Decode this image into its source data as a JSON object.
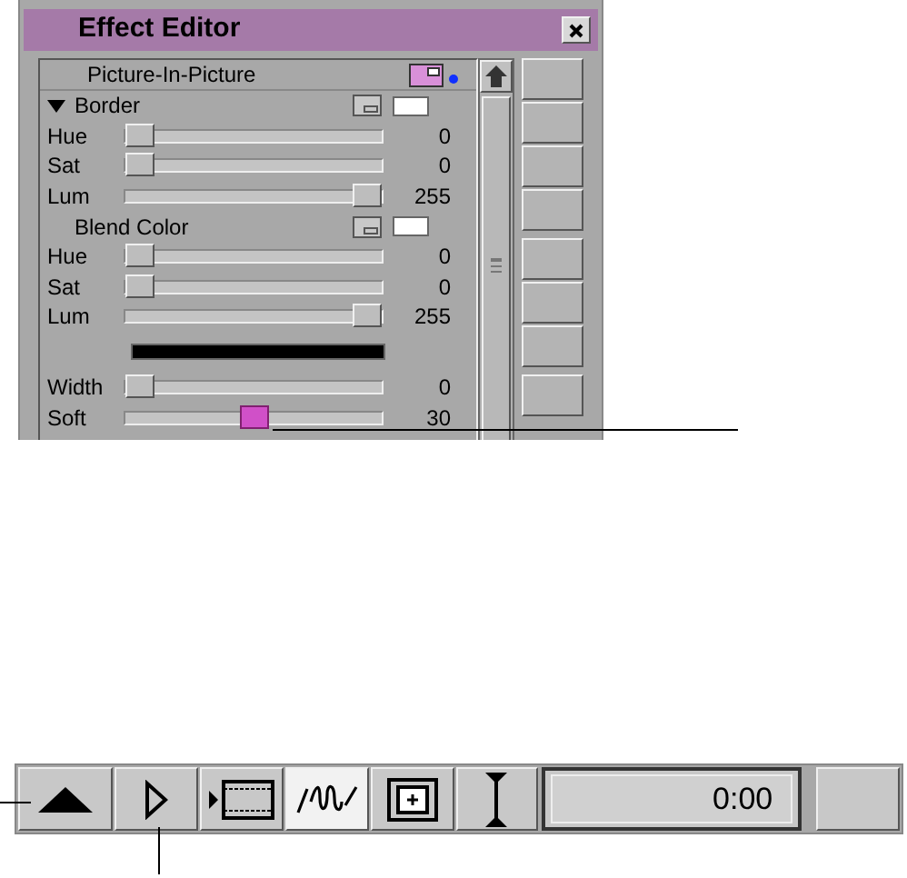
{
  "window": {
    "title": "Effect Editor"
  },
  "effect": {
    "name": "Picture-In-Picture"
  },
  "rows": [
    {
      "kind": "section",
      "label": "Border",
      "expanded": true
    },
    {
      "kind": "slider",
      "label": "Hue",
      "level": 0,
      "reading": "0",
      "selected": false
    },
    {
      "kind": "slider",
      "label": "Sat",
      "level": 0,
      "reading": "0",
      "selected": false
    },
    {
      "kind": "slider",
      "label": "Lum",
      "level": 1,
      "reading": "255",
      "selected": false
    },
    {
      "kind": "section",
      "label": "Blend Color"
    },
    {
      "kind": "slider",
      "label": "Hue",
      "level": 0,
      "reading": "0",
      "selected": false
    },
    {
      "kind": "slider",
      "label": "Sat",
      "level": 0,
      "reading": "0",
      "selected": false
    },
    {
      "kind": "slider",
      "label": "Lum",
      "level": 1,
      "reading": "255",
      "selected": false
    },
    {
      "kind": "color_bar"
    },
    {
      "kind": "slider",
      "label": "Width",
      "level": 0,
      "reading": "0",
      "selected": false
    },
    {
      "kind": "slider",
      "label": "Soft",
      "level": 0.5,
      "reading": "30",
      "selected": true
    }
  ],
  "toolbar": {
    "buttons": [
      {
        "kind": "eject",
        "selected": false
      },
      {
        "kind": "play",
        "selected": false
      },
      {
        "kind": "film",
        "selected": false
      },
      {
        "kind": "wave",
        "selected": true
      },
      {
        "kind": "frame",
        "selected": false
      },
      {
        "kind": "ibeam",
        "selected": false
      }
    ],
    "timecode": "0:00"
  }
}
